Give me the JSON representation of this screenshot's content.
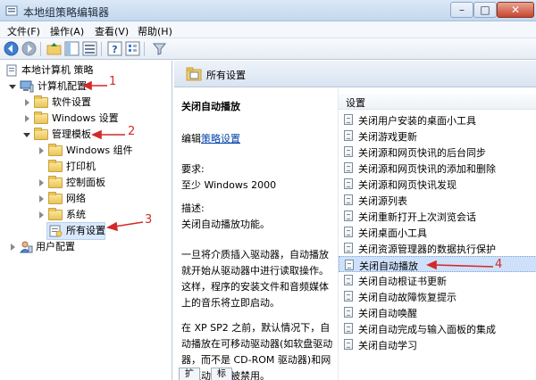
{
  "window": {
    "title": "本地组策略编辑器"
  },
  "menu": [
    "文件(F)",
    "操作(A)",
    "查看(V)",
    "帮助(H)"
  ],
  "tree": {
    "root": "本地计算机 策略",
    "computer_config": "计算机配置",
    "software_settings": "软件设置",
    "windows_settings": "Windows 设置",
    "admin_templates": "管理模板",
    "windows_components": "Windows 组件",
    "printers": "打印机",
    "control_panel": "控制面板",
    "network": "网络",
    "system": "系统",
    "all_settings": "所有设置",
    "user_config": "用户配置"
  },
  "right": {
    "header": "所有设置",
    "desc": {
      "title": "关闭自动播放",
      "edit_prefix": "编辑",
      "edit_link": "策略设置",
      "req_label": "要求:",
      "req_value": "至少 Windows 2000",
      "desc_label": "描述:",
      "desc_line": "关闭自动播放功能。",
      "para1": "一旦将介质插入驱动器，自动播放就开始从驱动器中进行读取操作。这样，程序的安装文件和音频媒体上的音乐将立即启动。",
      "para2": "在 XP SP2 之前，默认情况下，自动播放在可移动驱动器(如软盘驱动器，而不是 CD-ROM 驱动器)和网络驱动器上被禁用。"
    },
    "list_header": "设置",
    "items": [
      "关闭用户安装的桌面小工具",
      "关闭游戏更新",
      "关闭源和网页快讯的后台同步",
      "关闭源和网页快讯的添加和删除",
      "关闭源和网页快讯发现",
      "关闭源列表",
      "关闭重新打开上次浏览会话",
      "关闭桌面小工具",
      "关闭资源管理器的数据执行保护",
      "关闭自动播放",
      "关闭自动根证书更新",
      "关闭自动故障恢复提示",
      "关闭自动唤醒",
      "关闭自动完成与输入面板的集成",
      "关闭自动学习"
    ],
    "tabs": [
      "扩展",
      "标准"
    ]
  },
  "annotations": [
    "1",
    "2",
    "3",
    "4"
  ],
  "colors": {
    "arrow": "#d12a2a",
    "selection": "#cfe1fa",
    "link": "#0645ad"
  }
}
